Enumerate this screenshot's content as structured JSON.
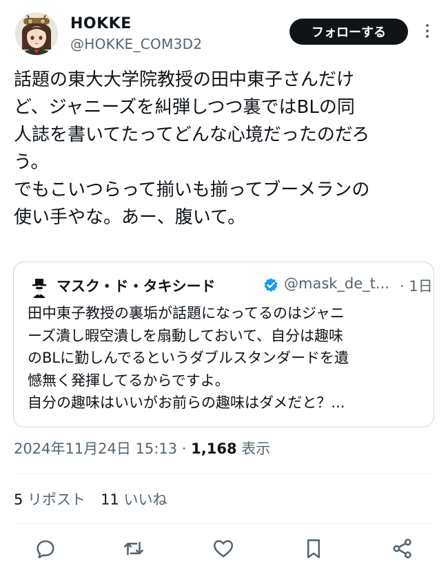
{
  "author": {
    "display_name": "HOKKE",
    "handle": "@HOKKE_COM3D2",
    "avatar_icon": "anime-girl-avatar-icon"
  },
  "header": {
    "follow_label": "フォローする",
    "more_icon": "more-vertical-icon"
  },
  "tweet": {
    "lines": [
      "話題の東大大学院教授の田中東子さんだけ",
      "ど、ジャニーズを糾弾しつつ裏ではBLの同",
      "人誌を書いてたってどんな心境だったのだろ",
      "う。",
      "でもこいつらって揃いも揃ってブーメランの",
      "使い手やな。あー、腹いて。"
    ]
  },
  "quote": {
    "display_name": "マスク・ド・タキシード",
    "handle": "@mask_de_t...",
    "time": "· 1日",
    "avatar_icon": "tuxedo-mask-avatar-icon",
    "verified_icon": "verified-badge-icon",
    "lines": [
      "田中東子教授の裏垢が話題になってるのはジャニ",
      "ーズ潰し暇空潰しを扇動しておいて、自分は趣味",
      "のBLに勤しんでるというダブルスタンダードを遺",
      "憾無く発揮してるからですよ。",
      "自分の趣味はいいがお前らの趣味はダメだと？..."
    ]
  },
  "meta": {
    "datetime": "2024年11月24日 15:13",
    "separator": " · ",
    "views_count": "1,168",
    "views_label": " 表示"
  },
  "stats": {
    "reposts_count": "5",
    "reposts_label": " リポスト",
    "likes_count": "11",
    "likes_label": " いいね"
  },
  "actions": [
    {
      "name": "reply-icon"
    },
    {
      "name": "retweet-icon"
    },
    {
      "name": "like-icon"
    },
    {
      "name": "bookmark-icon"
    },
    {
      "name": "share-icon"
    }
  ],
  "colors": {
    "text_primary": "#0f1419",
    "text_secondary": "#536471",
    "border": "#cfd9de",
    "divider": "#eff3f4",
    "verified": "#1d9bf0"
  }
}
